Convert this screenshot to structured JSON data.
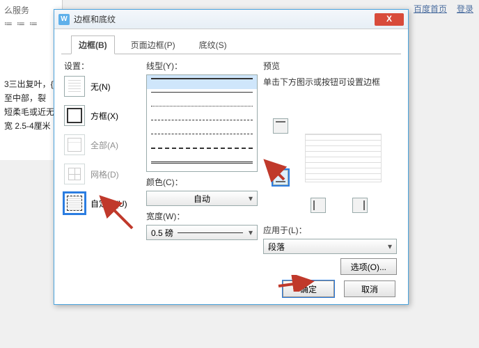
{
  "topLinks": {
    "home": "百度首页",
    "login": "登录"
  },
  "bgDoc": {
    "svc": "么服务",
    "lines": [
      "3三出复叶，{",
      "至中部，裂",
      "短柔毛或近无",
      "宽 2.5-4厘米"
    ]
  },
  "dialog": {
    "title": "边框和底纹",
    "tabs": {
      "border": "边框(B)",
      "page": "页面边框(P)",
      "shading": "底纹(S)"
    },
    "settings": {
      "label": "设置：",
      "none": "无(N)",
      "box": "方框(X)",
      "all": "全部(A)",
      "grid": "网格(D)",
      "custom": "自定义(U)"
    },
    "linetype": {
      "label": "线型(Y)："
    },
    "color": {
      "label": "颜色(C)：",
      "value": "自动"
    },
    "width": {
      "label": "宽度(W)：",
      "value": "0.5 磅"
    },
    "preview": {
      "label": "预览",
      "hint": "单击下方图示或按钮可设置边框"
    },
    "applyTo": {
      "label": "应用于(L)：",
      "value": "段落"
    },
    "optionsBtn": "选项(O)...",
    "ok": "确定",
    "cancel": "取消"
  }
}
